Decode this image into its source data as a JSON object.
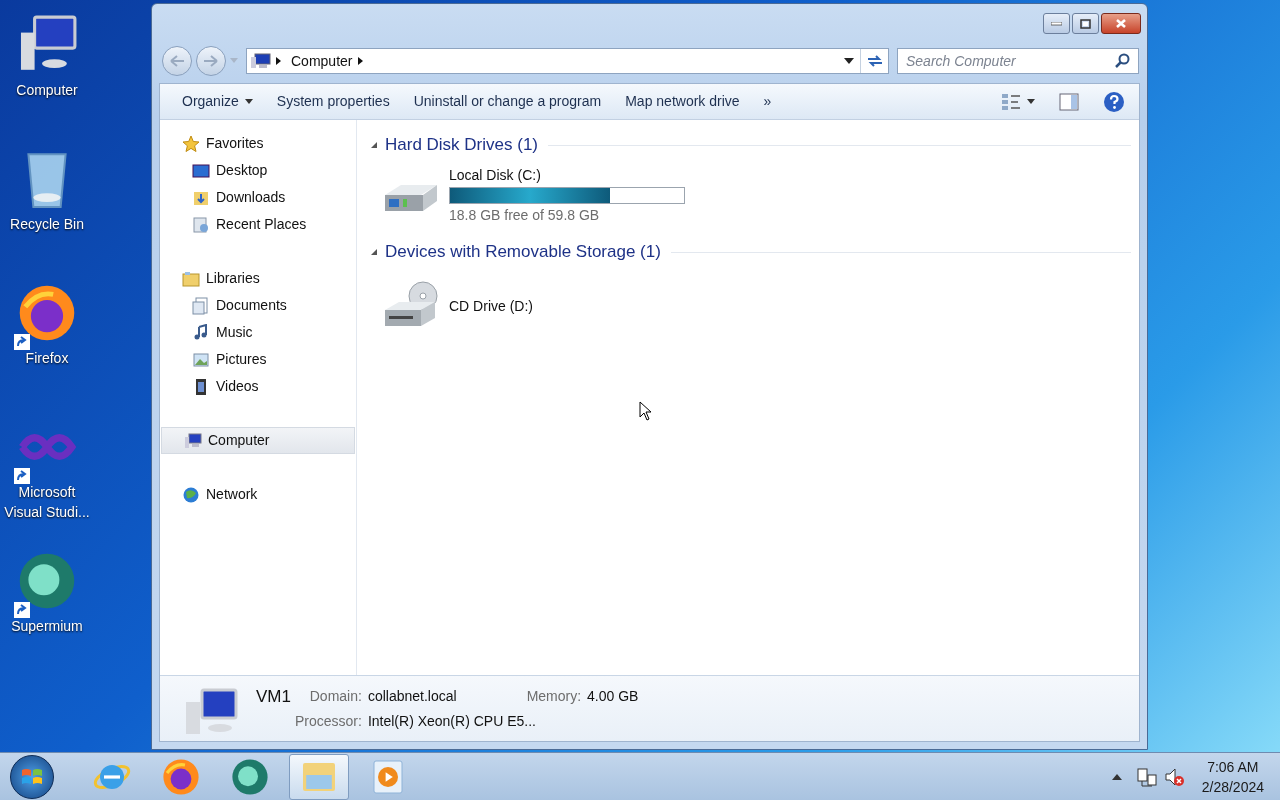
{
  "desktop_icons": [
    {
      "label": "Computer",
      "kind": "computer"
    },
    {
      "label": "Recycle Bin",
      "kind": "bin"
    },
    {
      "label": "Firefox",
      "kind": "firefox",
      "shortcut": true
    },
    {
      "label": "Microsoft Visual Studi...",
      "kind": "vs",
      "shortcut": true
    },
    {
      "label": "Supermium",
      "kind": "supermium",
      "shortcut": true
    }
  ],
  "window": {
    "address": {
      "crumbs": [
        "Computer"
      ]
    },
    "search": {
      "placeholder": "Search Computer"
    },
    "toolbar": [
      {
        "label": "Organize",
        "dropdown": true
      },
      {
        "label": "System properties",
        "dropdown": false
      },
      {
        "label": "Uninstall or change a program",
        "dropdown": false
      },
      {
        "label": "Map network drive",
        "dropdown": false
      },
      {
        "label": "»",
        "dropdown": false
      }
    ],
    "nav": [
      {
        "label": "Favorites",
        "kind": "star",
        "selected": false,
        "children": [
          {
            "label": "Desktop",
            "kind": "desktop",
            "selected": false
          },
          {
            "label": "Downloads",
            "kind": "folder",
            "selected": false
          },
          {
            "label": "Recent Places",
            "kind": "recent",
            "selected": false
          }
        ]
      },
      {
        "label": "Libraries",
        "kind": "library",
        "selected": false,
        "children": [
          {
            "label": "Documents",
            "kind": "doc",
            "selected": false
          },
          {
            "label": "Music",
            "kind": "music",
            "selected": false
          },
          {
            "label": "Pictures",
            "kind": "pictures",
            "selected": false
          },
          {
            "label": "Videos",
            "kind": "videos",
            "selected": false
          }
        ]
      },
      {
        "label": "Computer",
        "kind": "computer",
        "selected": true
      },
      {
        "label": "Network",
        "kind": "network",
        "selected": false
      }
    ],
    "groups": [
      {
        "title": "Hard Disk Drives (1)",
        "expanded": true,
        "drives": [
          {
            "name": "Local Disk (C:)",
            "kind": "hdd",
            "level": 0.685,
            "free": "18.8 GB free of 59.8 GB"
          }
        ]
      },
      {
        "title": "Devices with Removable Storage (1)",
        "expanded": true,
        "drives": [
          {
            "name": "CD Drive (D:)",
            "kind": "cd"
          }
        ]
      }
    ],
    "details": {
      "name": "VM1",
      "fields": [
        {
          "label": "Domain:",
          "value": "collabnet.local"
        },
        {
          "label": "Memory:",
          "value": "4.00 GB"
        },
        {
          "label": "Processor:",
          "value": "Intel(R) Xeon(R) CPU E5..."
        }
      ]
    }
  },
  "taskbar": {
    "apps": [
      {
        "kind": "ie",
        "selected": false
      },
      {
        "kind": "firefox",
        "selected": false
      },
      {
        "kind": "supermium",
        "selected": false
      },
      {
        "kind": "explorer",
        "selected": true
      },
      {
        "kind": "media",
        "selected": false
      }
    ],
    "tray": [
      {
        "kind": "network"
      },
      {
        "kind": "volume-muted"
      }
    ],
    "time": "7:06 AM",
    "date": "2/28/2024"
  }
}
